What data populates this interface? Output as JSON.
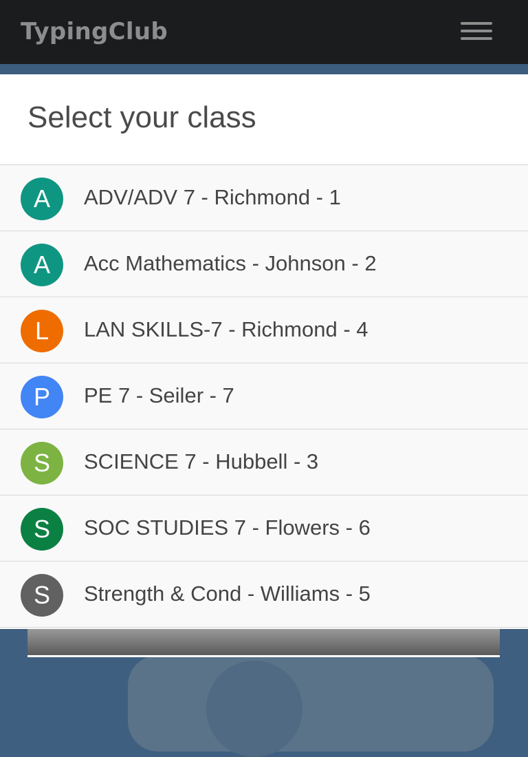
{
  "header": {
    "logo_text": "TypingClub",
    "menu_icon": "hamburger-menu-icon"
  },
  "modal": {
    "title": "Select your class",
    "classes": [
      {
        "initial": "A",
        "name": "ADV/ADV 7 - Richmond - 1",
        "color": "#0f9682"
      },
      {
        "initial": "A",
        "name": "Acc Mathematics - Johnson - 2",
        "color": "#0f9682"
      },
      {
        "initial": "L",
        "name": "LAN SKILLS-7 - Richmond - 4",
        "color": "#ef6c00"
      },
      {
        "initial": "P",
        "name": "PE 7 - Seiler - 7",
        "color": "#4285f4"
      },
      {
        "initial": "S",
        "name": "SCIENCE 7 - Hubbell - 3",
        "color": "#7cb342"
      },
      {
        "initial": "S",
        "name": "SOC STUDIES 7 - Flowers - 6",
        "color": "#0b8043"
      },
      {
        "initial": "S",
        "name": "Strength & Cond - Williams - 5",
        "color": "#616161"
      }
    ]
  },
  "colors": {
    "topbar": "#1b1c1e",
    "background": "#3f5f80",
    "modal": "#f9f9f9"
  }
}
